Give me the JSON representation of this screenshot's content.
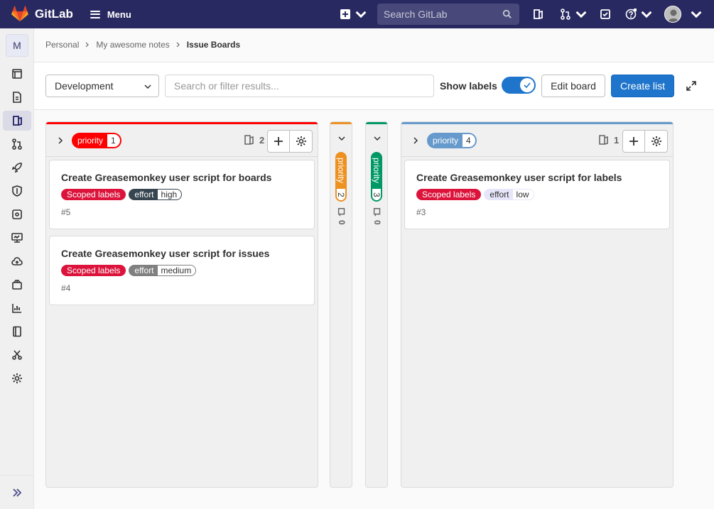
{
  "app": {
    "name": "GitLab",
    "menu_label": "Menu",
    "search_placeholder": "Search GitLab"
  },
  "sidebar": {
    "project_initial": "M"
  },
  "breadcrumb": {
    "items": [
      "Personal",
      "My awesome notes"
    ],
    "current": "Issue Boards"
  },
  "filters": {
    "board": "Development",
    "search_placeholder": "Search or filter results...",
    "show_labels": "Show labels",
    "show_labels_on": true,
    "edit_board": "Edit board",
    "create_list": "Create list"
  },
  "lists": [
    {
      "label_key": "priority",
      "label_value": "1",
      "color": "#ff0000",
      "issue_count": "2",
      "cards": [
        {
          "title": "Create Greasemonkey user script for boards",
          "scoped": "Scoped labels",
          "effort_key": "effort",
          "effort_value": "high",
          "effort_color": "#36454f",
          "ref": "#5"
        },
        {
          "title": "Create Greasemonkey user script for issues",
          "scoped": "Scoped labels",
          "effort_key": "effort",
          "effort_value": "medium",
          "effort_color": "#808080",
          "ref": "#4"
        }
      ]
    },
    {
      "label_key": "priority",
      "label_value": "2",
      "color": "#ed9121",
      "issue_count": "0",
      "collapsed": true
    },
    {
      "label_key": "priority",
      "label_value": "3",
      "color": "#009966",
      "issue_count": "0",
      "collapsed": true
    },
    {
      "label_key": "priority",
      "label_value": "4",
      "color": "#6699cc",
      "issue_count": "1",
      "cards": [
        {
          "title": "Create Greasemonkey user script for labels",
          "scoped": "Scoped labels",
          "effort_key": "effort",
          "effort_value": "low",
          "effort_color": "#e6e6fa",
          "ref": "#3"
        }
      ]
    }
  ]
}
